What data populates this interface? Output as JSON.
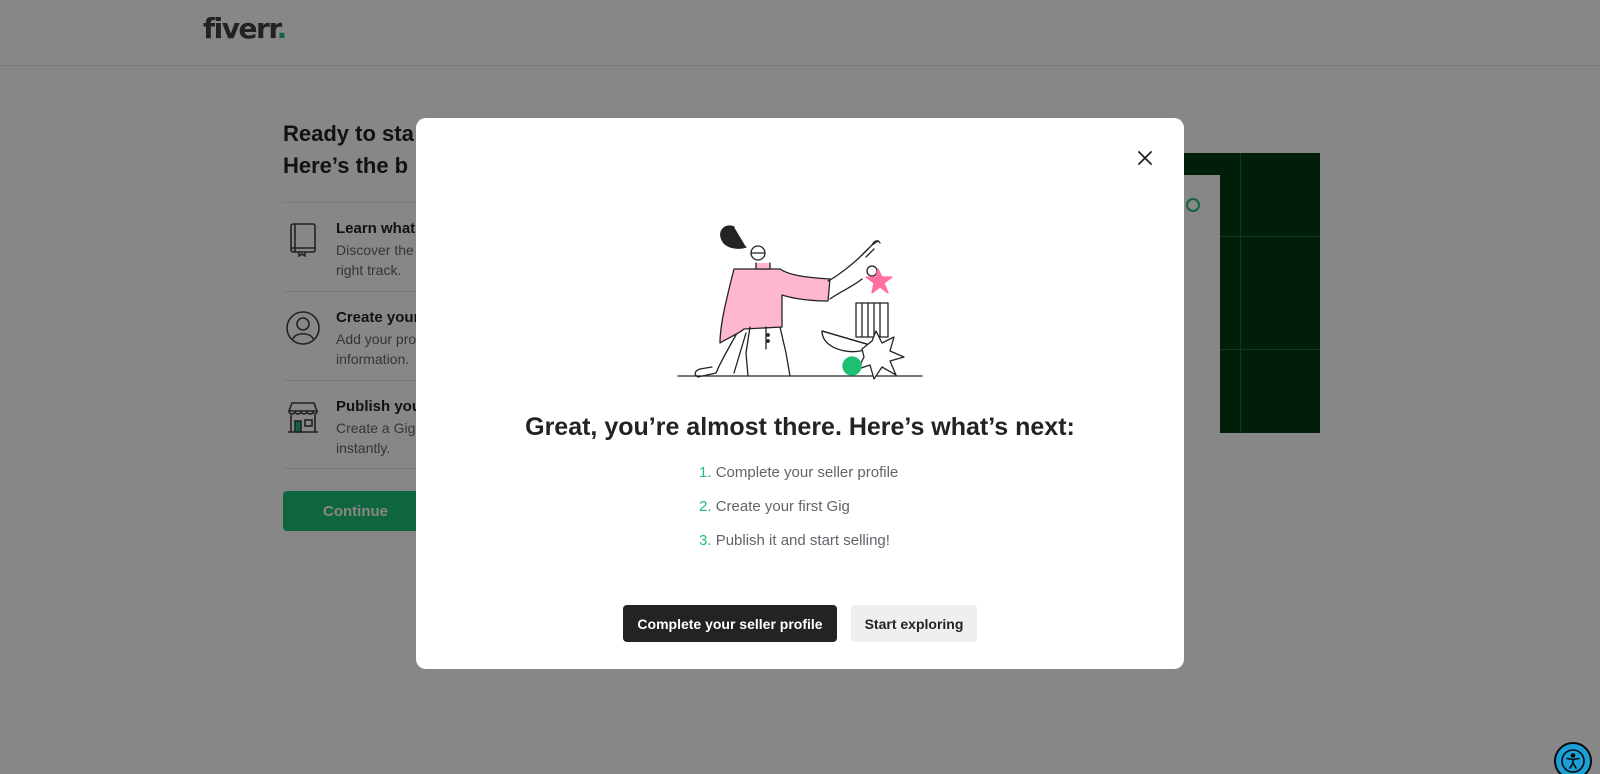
{
  "header": {
    "logo_text": "fiverr",
    "logo_dot": "."
  },
  "background": {
    "title_line1": "Ready to sta",
    "title_line2": "Here’s the b",
    "steps": [
      {
        "icon": "book-icon",
        "title": "Learn what",
        "desc_line1": "Discover the",
        "desc_line2": "right track."
      },
      {
        "icon": "user-circle-icon",
        "title": "Create your",
        "desc_line1": "Add your pro",
        "desc_line2": "information."
      },
      {
        "icon": "storefront-icon",
        "title": "Publish you",
        "desc_line1": "Create a Gig",
        "desc_line2": "instantly."
      }
    ],
    "continue_label": "Continue"
  },
  "modal": {
    "title": "Great, you’re almost there. Here’s what’s next:",
    "items": [
      {
        "num": "1.",
        "text": "Complete your seller profile"
      },
      {
        "num": "2.",
        "text": "Create your first Gig"
      },
      {
        "num": "3.",
        "text": "Publish it and start selling!"
      }
    ],
    "primary_label": "Complete your seller profile",
    "secondary_label": "Start exploring"
  },
  "colors": {
    "accent": "#1dbf73",
    "dark": "#222325",
    "panel_green": "#003912",
    "illustration_pink": "#ffb6d0",
    "overlay": "rgba(0,0,0,0.47)"
  }
}
